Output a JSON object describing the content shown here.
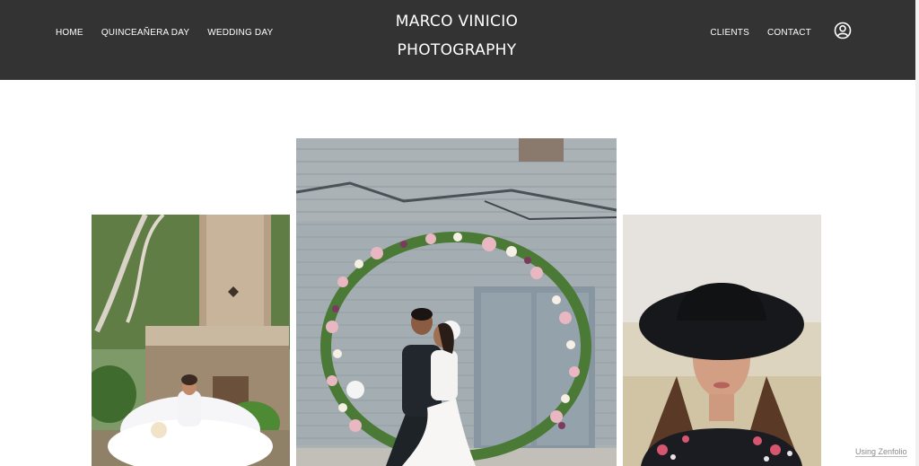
{
  "header": {
    "brand_line1": "MARCO VINICIO",
    "brand_line2": "PHOTOGRAPHY",
    "nav_left": [
      "HOME",
      "QUINCEAÑERA DAY",
      "WEDDING DAY"
    ],
    "nav_right": [
      "CLIENTS",
      "CONTACT"
    ],
    "account_icon": "user-circle-icon",
    "background": "#333333"
  },
  "gallery": {
    "photos": [
      {
        "subject": "quinceañera in white ball gown in a garden"
      },
      {
        "subject": "couple kissing under floral circle arch"
      },
      {
        "subject": "portrait of young woman in black wide-brim hat"
      }
    ]
  },
  "footer": {
    "credit": "Using Zenfolio"
  }
}
